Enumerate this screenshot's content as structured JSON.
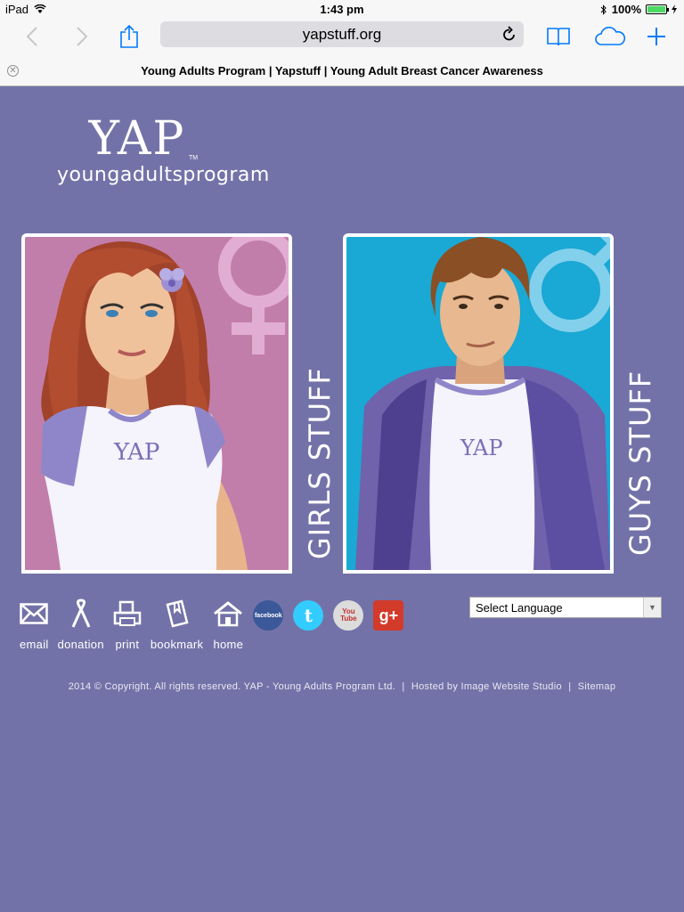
{
  "status": {
    "device": "iPad",
    "time": "1:43 pm",
    "battery": "100%",
    "battery_level": 1.0
  },
  "browser": {
    "url": "yapstuff.org",
    "tab_title": "Young Adults Program | Yapstuff | Young Adult Breast Cancer Awareness"
  },
  "logo": {
    "main": "YAP",
    "tm": "TM",
    "sub": "youngadultsprogram"
  },
  "cards": {
    "girls": {
      "label": "GIRLS STUFF",
      "shirt": "YAP",
      "color": "#c27eaa"
    },
    "guys": {
      "label": "GUYS STUFF",
      "shirt": "YAP",
      "color": "#1aa8d4"
    }
  },
  "footer": {
    "links": [
      "email",
      "donation",
      "print",
      "bookmark",
      "home"
    ],
    "social": [
      {
        "name": "facebook",
        "text": "facebook",
        "color": "#3b5998"
      },
      {
        "name": "twitter",
        "text": "t",
        "color": "#33ccff"
      },
      {
        "name": "youtube",
        "text": "You Tube",
        "color": "#dcdcdc"
      },
      {
        "name": "google-plus",
        "text": "g+",
        "color": "#d23a2a"
      }
    ],
    "language_select": "Select Language",
    "copyright": "2014 © Copyright. All rights reserved. YAP - Young Adults Program Ltd.",
    "separator": "|",
    "hosted_by": "Hosted by Image Website Studio",
    "sitemap": "Sitemap"
  },
  "colors": {
    "background": "#7372a8",
    "ios_blue": "#007aff"
  }
}
